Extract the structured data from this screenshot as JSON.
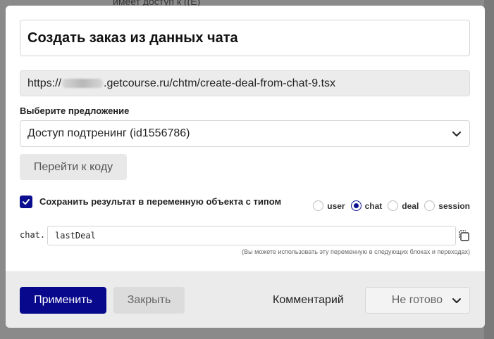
{
  "background": {
    "text": "имеет доступ к ((E)"
  },
  "modal": {
    "title": "Создать заказ из данных чата",
    "url": {
      "prefix": "https://",
      "suffix": ".getcourse.ru/chtm/create-deal-from-chat-9.tsx"
    },
    "offer": {
      "label": "Выберите предложение",
      "selected": "Доступ подтренинг (id1556786)"
    },
    "goto_code_label": "Перейти к коду",
    "save_result": {
      "checked": true,
      "label": "Сохранить результат в переменную объекта с типом",
      "types": [
        {
          "label": "user",
          "selected": false
        },
        {
          "label": "chat",
          "selected": true
        },
        {
          "label": "deal",
          "selected": false
        },
        {
          "label": "session",
          "selected": false
        }
      ]
    },
    "variable": {
      "prefix": "chat.",
      "value": "lastDeal",
      "hint": "(Вы можете использовать эту переменную в следующих блоках и переходах)"
    },
    "footer": {
      "apply_label": "Применить",
      "close_label": "Закрыть",
      "comment_label": "Комментарий",
      "status_label": "Не готово"
    }
  },
  "colors": {
    "accent": "#08088c",
    "checkbox": "#0b0f8f"
  }
}
